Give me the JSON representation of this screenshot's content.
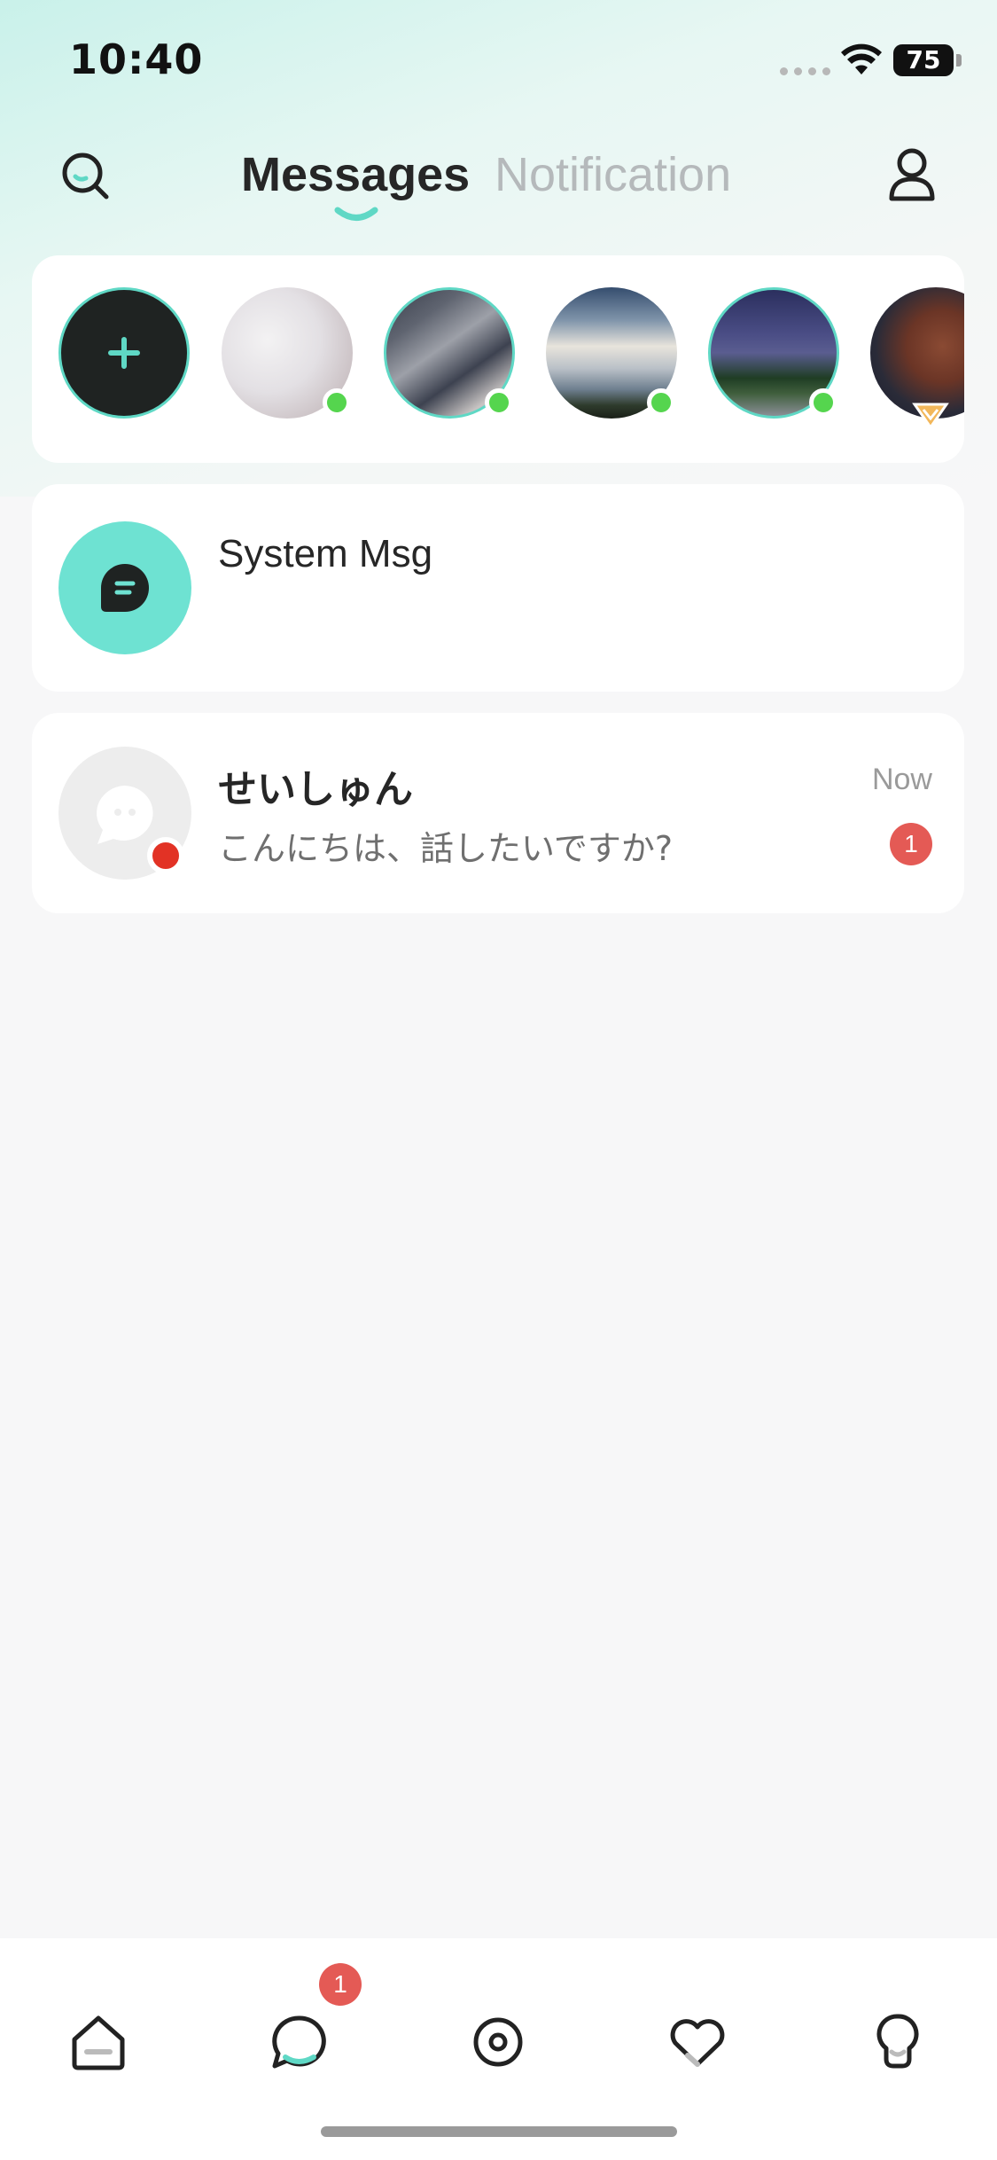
{
  "status_bar": {
    "time": "10:40",
    "battery": "75",
    "icons": [
      "signal-dots-icon",
      "wifi-icon",
      "battery-icon"
    ]
  },
  "header": {
    "tabs": [
      {
        "label": "Messages",
        "active": true
      },
      {
        "label": "Notification",
        "active": false
      }
    ],
    "icons": [
      "search-icon",
      "profile-icon"
    ],
    "accent_color": "#5fd8c5"
  },
  "stories": {
    "add_icon": "plus-icon",
    "items": [
      {
        "image": "white-shirt-photo",
        "online": true
      },
      {
        "image": "cap-selfie-photo",
        "online": true
      },
      {
        "image": "cloudy-sky-photo",
        "online": true
      },
      {
        "image": "night-road-photo",
        "online": true
      },
      {
        "image": "man-headphones-photo",
        "online": false,
        "vip": true
      }
    ]
  },
  "system_message": {
    "title": "System Msg",
    "icon": "chat-bubble-icon"
  },
  "chats": [
    {
      "name": "せいしゅん",
      "preview": "こんにちは、話したいですか?",
      "time": "Now",
      "unread": "1"
    }
  ],
  "bottom_nav": {
    "items": [
      "home-icon",
      "messages-icon",
      "discover-icon",
      "likes-icon",
      "profile-bulb-icon"
    ],
    "messages_badge": "1"
  },
  "colors": {
    "online": "#55d54e",
    "badge": "#e45a55",
    "system_avatar": "#6ee2d2"
  }
}
